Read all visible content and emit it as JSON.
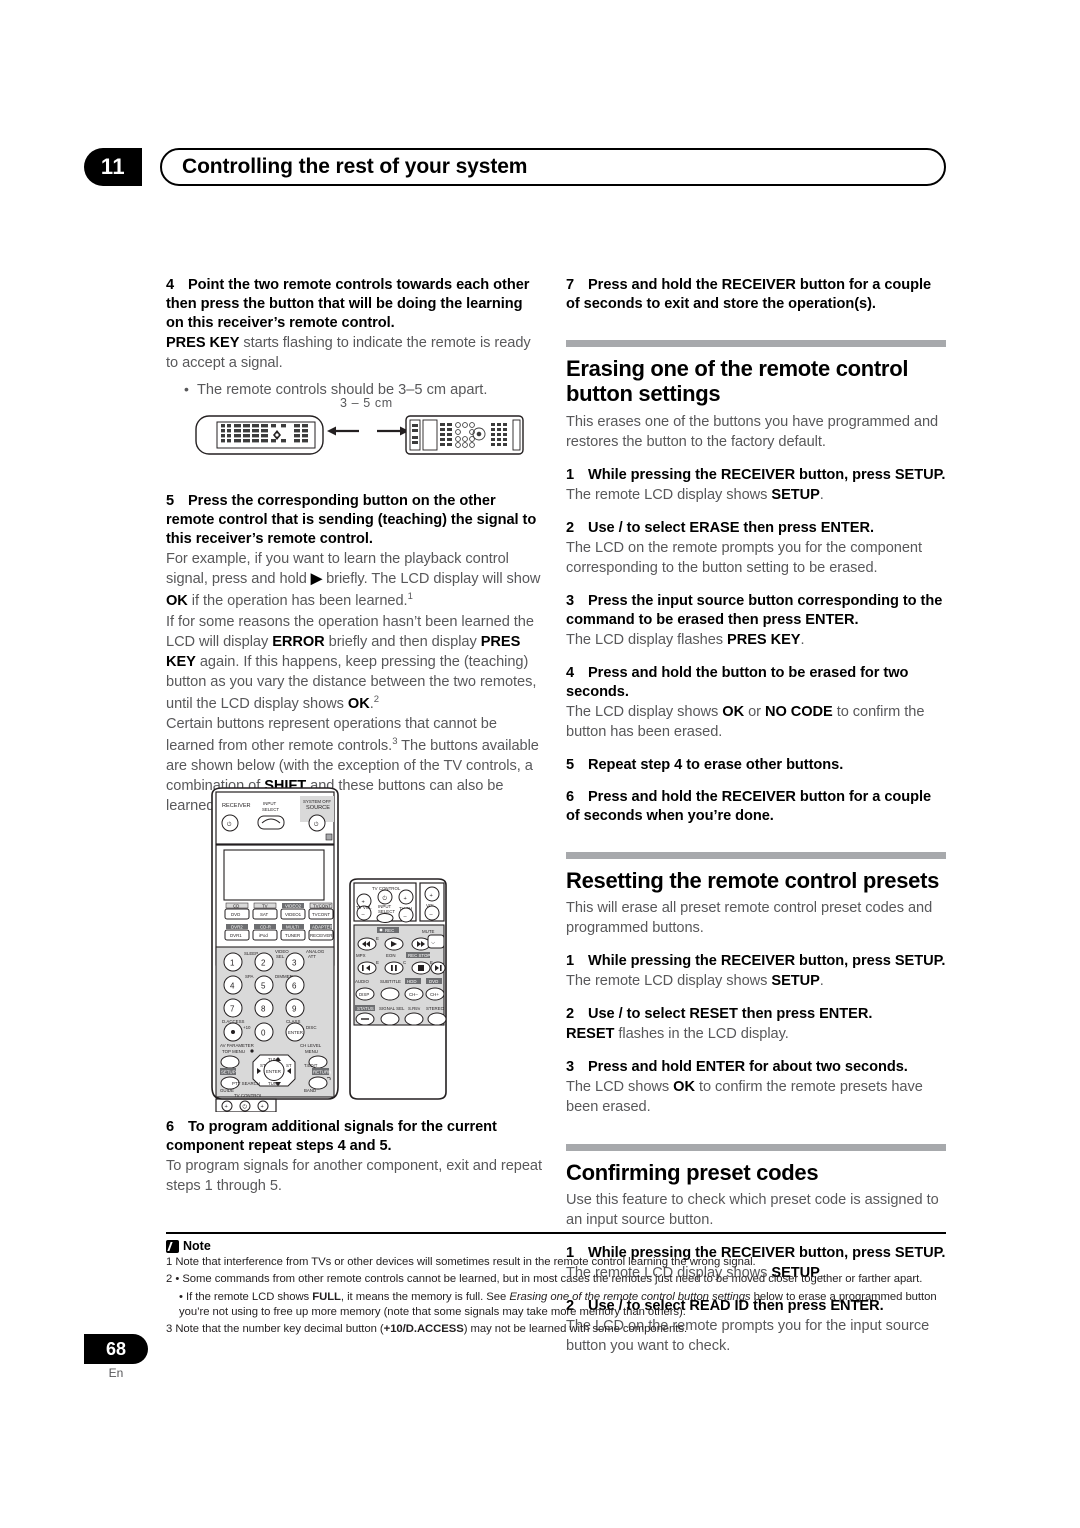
{
  "header": {
    "chapter_number": "11",
    "chapter_title": "Controlling the rest of your system"
  },
  "left_column": {
    "step4": {
      "number": "4",
      "text": "Point the two remote controls towards each other then press the button that will be doing the learning on this receiver’s remote control.",
      "body_a": "PRES KEY",
      "body_b": " starts flashing to indicate the remote is ready to accept a signal.",
      "bullet": "The remote controls should be 3–5 cm apart."
    },
    "distance_diagram": {
      "label": "3 – 5 cm",
      "left_remote": "learning-remote",
      "right_remote": "teaching-remote"
    },
    "step5": {
      "number": "5",
      "text": "Press the corresponding button on the other remote control that is sending (teaching) the signal to this receiver’s remote control.",
      "p1_a": "For example, if you want to learn the playback control signal, press and hold ",
      "p1_play": "▶",
      "p1_b": " briefly. The LCD display will show ",
      "p1_ok": "OK",
      "p1_c": " if the operation has been learned.",
      "p1_sup": "1",
      "p2_a": "If for some reasons the operation hasn’t been learned the LCD will display ",
      "p2_error": "ERROR",
      "p2_b": " briefly and then display ",
      "p2_preskey": "PRES KEY",
      "p2_c": " again. If this happens, keep pressing the (teaching) button as you vary the distance between the two remotes, until the LCD display shows ",
      "p2_ok": "OK",
      "p2_d": ".",
      "p2_sup": "2",
      "p3_a": "Certain buttons represent operations that cannot be learned from other remote controls.",
      "p3_sup": "3",
      "p3_b": " The buttons available are shown below (with the exception of the TV controls, a combination of ",
      "p3_shift": "SHIFT",
      "p3_c": " and these buttons can also be learned):"
    },
    "step6": {
      "number": "6",
      "text": "To program additional signals for the current component repeat steps 4 and 5.",
      "body": "To program signals for another component, exit and repeat steps 1 through 5."
    },
    "remote_figure": {
      "top_labels": [
        "RECEIVER",
        "INPUT SELECT",
        "SYSTEM OFF",
        "SOURCE"
      ],
      "source_buttons": [
        [
          "CD",
          "DVD"
        ],
        [
          "TV",
          "SAT"
        ],
        [
          "VIDEO2",
          "VIDEO1"
        ],
        [
          "TVCONT",
          "TVCONT"
        ]
      ],
      "source_buttons_row2": [
        [
          "DVR2",
          "DVR1"
        ],
        [
          "CD-R",
          "iPod"
        ],
        [
          "MULTI",
          "TUNER"
        ],
        [
          "ADAPTER",
          "RECEIVER"
        ]
      ],
      "numeric_keys": [
        "1",
        "2",
        "3",
        "4",
        "5",
        "6",
        "7",
        "8",
        "9",
        "•",
        "0",
        "ENTER"
      ],
      "numeric_shift_labels": [
        "SLEEP",
        "VIDEO SEL",
        "ANALOG ATT",
        "SPA",
        "DIMMER",
        "D.ACCESS +10",
        "CLASS",
        "DISC"
      ],
      "nav_labels": [
        "AV PARAMETER",
        "TOP MENU",
        "CH LEVEL",
        "MENU",
        "SETUP",
        "T.EDIT",
        "RETURN",
        "GUIDE",
        "PTY SEARCH",
        "BAND",
        "TUNE",
        "ENTER"
      ],
      "tv_control": [
        "TV CONTROL",
        "TV VOL",
        "INPUT SELECT",
        "TV CH",
        "VOL"
      ],
      "transport_labels": [
        "REC",
        "MUTE",
        "MPX",
        "EON",
        "REC STOP",
        "AUDIO",
        "SUBTITLE",
        "HDD",
        "DVD",
        "DISP",
        "STATUS",
        "SIGNAL SEL",
        "S.Rtrv",
        "STEREO"
      ]
    }
  },
  "right_column": {
    "step7": {
      "number": "7",
      "text": "Press and hold the RECEIVER button for a couple of seconds to exit and store the operation(s)."
    },
    "section_erase": {
      "heading": "Erasing one of the remote control button settings",
      "intro": "This erases one of the buttons you have programmed and restores the button to the factory default.",
      "steps": [
        {
          "number": "1",
          "text": "While pressing the RECEIVER button, press SETUP.",
          "body_a": "The remote LCD display shows ",
          "body_b": "SETUP",
          "body_c": "."
        },
        {
          "number": "2",
          "text": "Use  /  to select ERASE then press ENTER.",
          "body_a": "The LCD on the remote prompts you for the component corresponding to the button setting to be erased.",
          "body_b": "",
          "body_c": ""
        },
        {
          "number": "3",
          "text": "Press the input source button corresponding to the command to be erased then press ENTER.",
          "body_a": "The LCD display flashes ",
          "body_b": "PRES KEY",
          "body_c": "."
        },
        {
          "number": "4",
          "text": "Press and hold the button to be erased for two seconds.",
          "body_a": "The LCD display shows ",
          "body_b": "OK",
          "body_mid": " or ",
          "body_b2": "NO CODE",
          "body_c": " to confirm the button has been erased."
        },
        {
          "number": "5",
          "text": "Repeat step 4 to erase other buttons.",
          "body_a": "",
          "body_b": "",
          "body_c": ""
        },
        {
          "number": "6",
          "text": "Press and hold the RECEIVER button for a couple of seconds when you’re done.",
          "body_a": "",
          "body_b": "",
          "body_c": ""
        }
      ]
    },
    "section_reset": {
      "heading": "Resetting the remote control presets",
      "intro": "This will erase all preset remote control preset codes and programmed buttons.",
      "steps": [
        {
          "number": "1",
          "text": "While pressing the RECEIVER button, press SETUP.",
          "body_a": "The remote LCD display shows ",
          "body_b": "SETUP",
          "body_c": "."
        },
        {
          "number": "2",
          "text": "Use  /  to select RESET then press ENTER.",
          "body_a": "",
          "body_b": "RESET",
          "body_c": " flashes in the LCD display."
        },
        {
          "number": "3",
          "text": "Press and hold ENTER for about two seconds.",
          "body_a": "The LCD shows ",
          "body_b": "OK",
          "body_c": " to confirm the remote presets have been erased."
        }
      ]
    },
    "section_confirm": {
      "heading": "Confirming preset codes",
      "intro": "Use this feature to check which preset code is assigned to an input source button.",
      "steps": [
        {
          "number": "1",
          "text": "While pressing the RECEIVER button, press SETUP.",
          "body_a": "The remote LCD display shows ",
          "body_b": "SETUP",
          "body_c": "."
        },
        {
          "number": "2",
          "text": "Use  /  to select READ ID then press ENTER.",
          "body_a": "The LCD on the remote prompts you for the input source button you want to check.",
          "body_b": "",
          "body_c": ""
        }
      ]
    }
  },
  "notes": {
    "title": "Note",
    "n1": "1 Note that interference from TVs or other devices will sometimes result in the remote control learning the wrong signal.",
    "n2a": "2 • Some commands from other remote controls cannot be learned, but in most cases the remotes just need to be moved closer together or farther apart.",
    "n2b_a": "• If the remote LCD shows ",
    "n2b_full": "FULL",
    "n2b_b": ", it means the memory is full. See ",
    "n2b_italic": "Erasing one of the remote control button settings",
    "n2b_c": " below to erase a programmed button you’re not using to free up more memory (note that some signals may take more memory than others).",
    "n3_a": "3 Note that the number key decimal button (",
    "n3_bold": "+10/D.ACCESS",
    "n3_b": ") may not be learned with some components."
  },
  "footer": {
    "page_number": "68",
    "language": "En"
  }
}
